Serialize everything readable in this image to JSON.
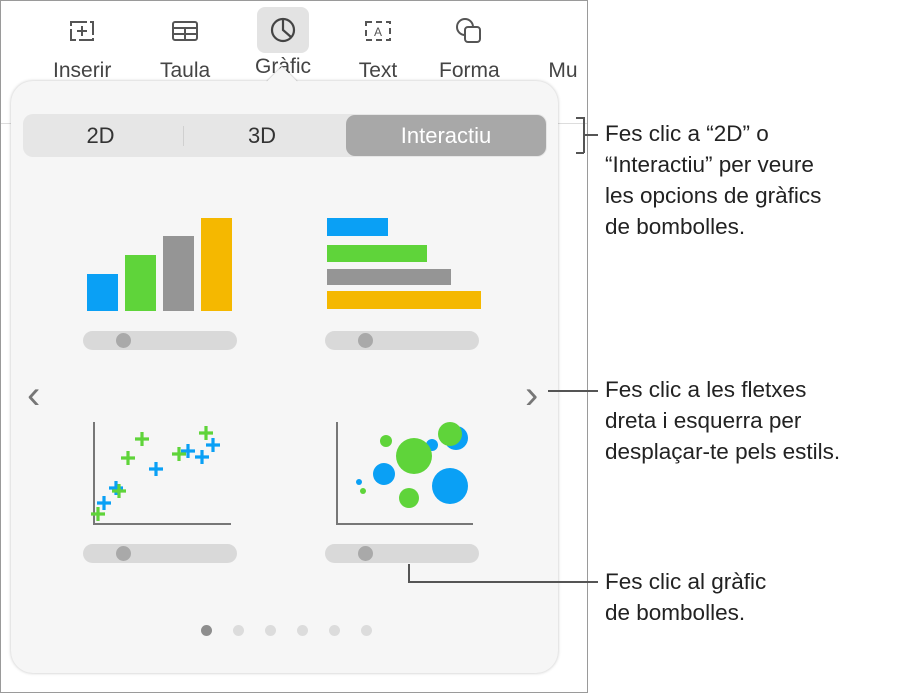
{
  "toolbar": {
    "items": [
      {
        "label": "Inserir",
        "icon": "insert-icon"
      },
      {
        "label": "Taula",
        "icon": "table-icon"
      },
      {
        "label": "Gràfic",
        "icon": "chart-icon",
        "active": true
      },
      {
        "label": "Text",
        "icon": "text-box-icon"
      },
      {
        "label": "Forma",
        "icon": "shape-icon"
      },
      {
        "label": "Mu",
        "icon": "media-icon"
      }
    ]
  },
  "popover": {
    "tabs": [
      {
        "label": "2D"
      },
      {
        "label": "3D"
      },
      {
        "label": "Interactiu",
        "selected": true
      }
    ],
    "charts": [
      "interactive-column-chart",
      "interactive-bar-chart",
      "interactive-scatter-chart",
      "interactive-bubble-chart"
    ],
    "page_count": 6,
    "current_page": 1
  },
  "callouts": [
    {
      "text": "Fes clic a “2D” o\n“Interactiu” per veure\nles opcions de gràfics\nde bombolles."
    },
    {
      "text": "Fes clic a les fletxes\ndreta i esquerra per\ndesplaçar-te pels estils."
    },
    {
      "text": "Fes clic al gràfic\nde bombolles."
    }
  ],
  "colors": {
    "blue": "#0aa0f5",
    "green": "#5fd43a",
    "gray": "#959595",
    "yellow": "#f5b800",
    "selected_tab": "#a8a8a8"
  }
}
